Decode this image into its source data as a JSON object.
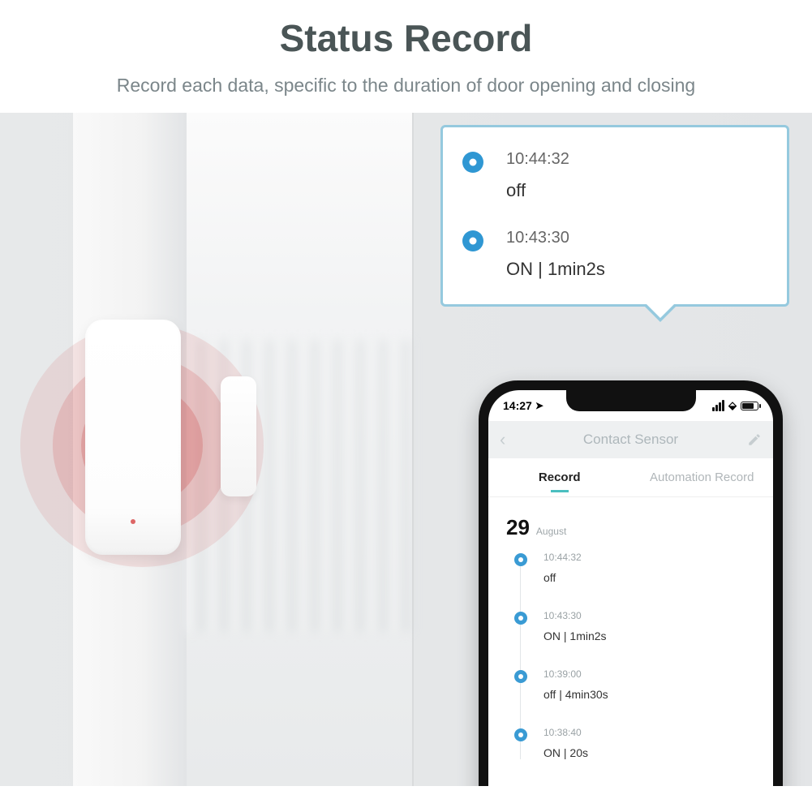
{
  "header": {
    "title": "Status Record",
    "subtitle": "Record each data, specific to the duration of door opening and closing"
  },
  "callout": {
    "items": [
      {
        "time": "10:44:32",
        "state": "off"
      },
      {
        "time": "10:43:30",
        "state": "ON  | 1min2s"
      }
    ]
  },
  "phone": {
    "statusbar": {
      "time": "14:27",
      "nav_icon": "↖"
    },
    "appbar": {
      "title": "Contact Sensor"
    },
    "tabs": {
      "record": "Record",
      "automation": "Automation Record"
    },
    "date": {
      "day": "29",
      "month": "August"
    },
    "records": [
      {
        "time": "10:44:32",
        "state": "off"
      },
      {
        "time": "10:43:30",
        "state": "ON  | 1min2s"
      },
      {
        "time": "10:39:00",
        "state": "off  | 4min30s"
      },
      {
        "time": "10:38:40",
        "state": "ON  | 20s"
      }
    ]
  }
}
